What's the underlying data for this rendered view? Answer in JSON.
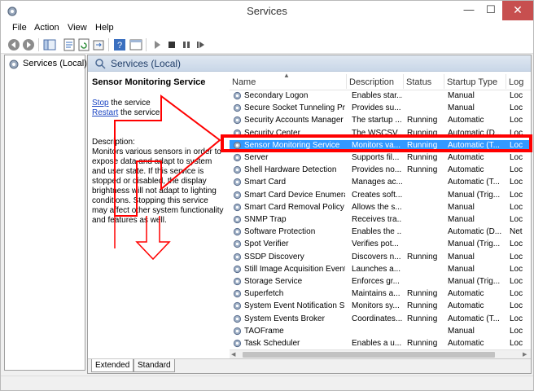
{
  "window": {
    "title": "Services"
  },
  "title_controls": {
    "minimize": "—",
    "maximize": "☐",
    "close": "✕"
  },
  "menu": [
    "File",
    "Action",
    "View",
    "Help"
  ],
  "tree": {
    "root_label": "Services (Local)"
  },
  "content": {
    "header_title": "Services (Local)"
  },
  "details": {
    "service_name": "Sensor Monitoring Service",
    "stop_link": "Stop",
    "stop_suffix": " the service",
    "restart_link": "Restart",
    "restart_suffix": " the service",
    "description_label": "Description:",
    "description_text": "Monitors various sensors in order to expose data and adapt to system and user state.  If this service is stopped or disabled, the display brightness will not adapt to lighting conditions. Stopping this service may affect other system functionality and features as well."
  },
  "columns": [
    "Name",
    "Description",
    "Status",
    "Startup Type",
    "Log"
  ],
  "services": [
    {
      "name": "Secondary Logon",
      "description": "Enables star...",
      "status": "",
      "startup": "Manual",
      "logon": "Loc"
    },
    {
      "name": "Secure Socket Tunneling Pr...",
      "description": "Provides su...",
      "status": "",
      "startup": "Manual",
      "logon": "Loc"
    },
    {
      "name": "Security Accounts Manager",
      "description": "The startup ...",
      "status": "Running",
      "startup": "Automatic",
      "logon": "Loc"
    },
    {
      "name": "Security Center",
      "description": "The WSCSV...",
      "status": "Running",
      "startup": "Automatic (D...",
      "logon": "Loc"
    },
    {
      "name": "Sensor Monitoring Service",
      "description": "Monitors va...",
      "status": "Running",
      "startup": "Automatic (T...",
      "logon": "Loc",
      "selected": true
    },
    {
      "name": "Server",
      "description": "Supports fil...",
      "status": "Running",
      "startup": "Automatic",
      "logon": "Loc"
    },
    {
      "name": "Shell Hardware Detection",
      "description": "Provides no...",
      "status": "Running",
      "startup": "Automatic",
      "logon": "Loc"
    },
    {
      "name": "Smart Card",
      "description": "Manages ac...",
      "status": "",
      "startup": "Automatic (T...",
      "logon": "Loc"
    },
    {
      "name": "Smart Card Device Enumera...",
      "description": "Creates soft...",
      "status": "",
      "startup": "Manual (Trig...",
      "logon": "Loc"
    },
    {
      "name": "Smart Card Removal Policy",
      "description": "Allows the s...",
      "status": "",
      "startup": "Manual",
      "logon": "Loc"
    },
    {
      "name": "SNMP Trap",
      "description": "Receives tra...",
      "status": "",
      "startup": "Manual",
      "logon": "Loc"
    },
    {
      "name": "Software Protection",
      "description": "Enables the ...",
      "status": "",
      "startup": "Automatic (D...",
      "logon": "Net"
    },
    {
      "name": "Spot Verifier",
      "description": "Verifies pot...",
      "status": "",
      "startup": "Manual (Trig...",
      "logon": "Loc"
    },
    {
      "name": "SSDP Discovery",
      "description": "Discovers n...",
      "status": "Running",
      "startup": "Manual",
      "logon": "Loc"
    },
    {
      "name": "Still Image Acquisition Events",
      "description": "Launches a...",
      "status": "",
      "startup": "Manual",
      "logon": "Loc"
    },
    {
      "name": "Storage Service",
      "description": "Enforces gr...",
      "status": "",
      "startup": "Manual (Trig...",
      "logon": "Loc"
    },
    {
      "name": "Superfetch",
      "description": "Maintains a...",
      "status": "Running",
      "startup": "Automatic",
      "logon": "Loc"
    },
    {
      "name": "System Event Notification S...",
      "description": "Monitors sy...",
      "status": "Running",
      "startup": "Automatic",
      "logon": "Loc"
    },
    {
      "name": "System Events Broker",
      "description": "Coordinates...",
      "status": "Running",
      "startup": "Automatic (T...",
      "logon": "Loc"
    },
    {
      "name": "TAOFrame",
      "description": "",
      "status": "",
      "startup": "Manual",
      "logon": "Loc"
    },
    {
      "name": "Task Scheduler",
      "description": "Enables a u...",
      "status": "Running",
      "startup": "Automatic",
      "logon": "Loc"
    }
  ],
  "tabs": [
    "Extended",
    "Standard"
  ],
  "colors": {
    "selection": "#3399ff",
    "annotation": "#ff0000",
    "link": "#1a44c2"
  }
}
